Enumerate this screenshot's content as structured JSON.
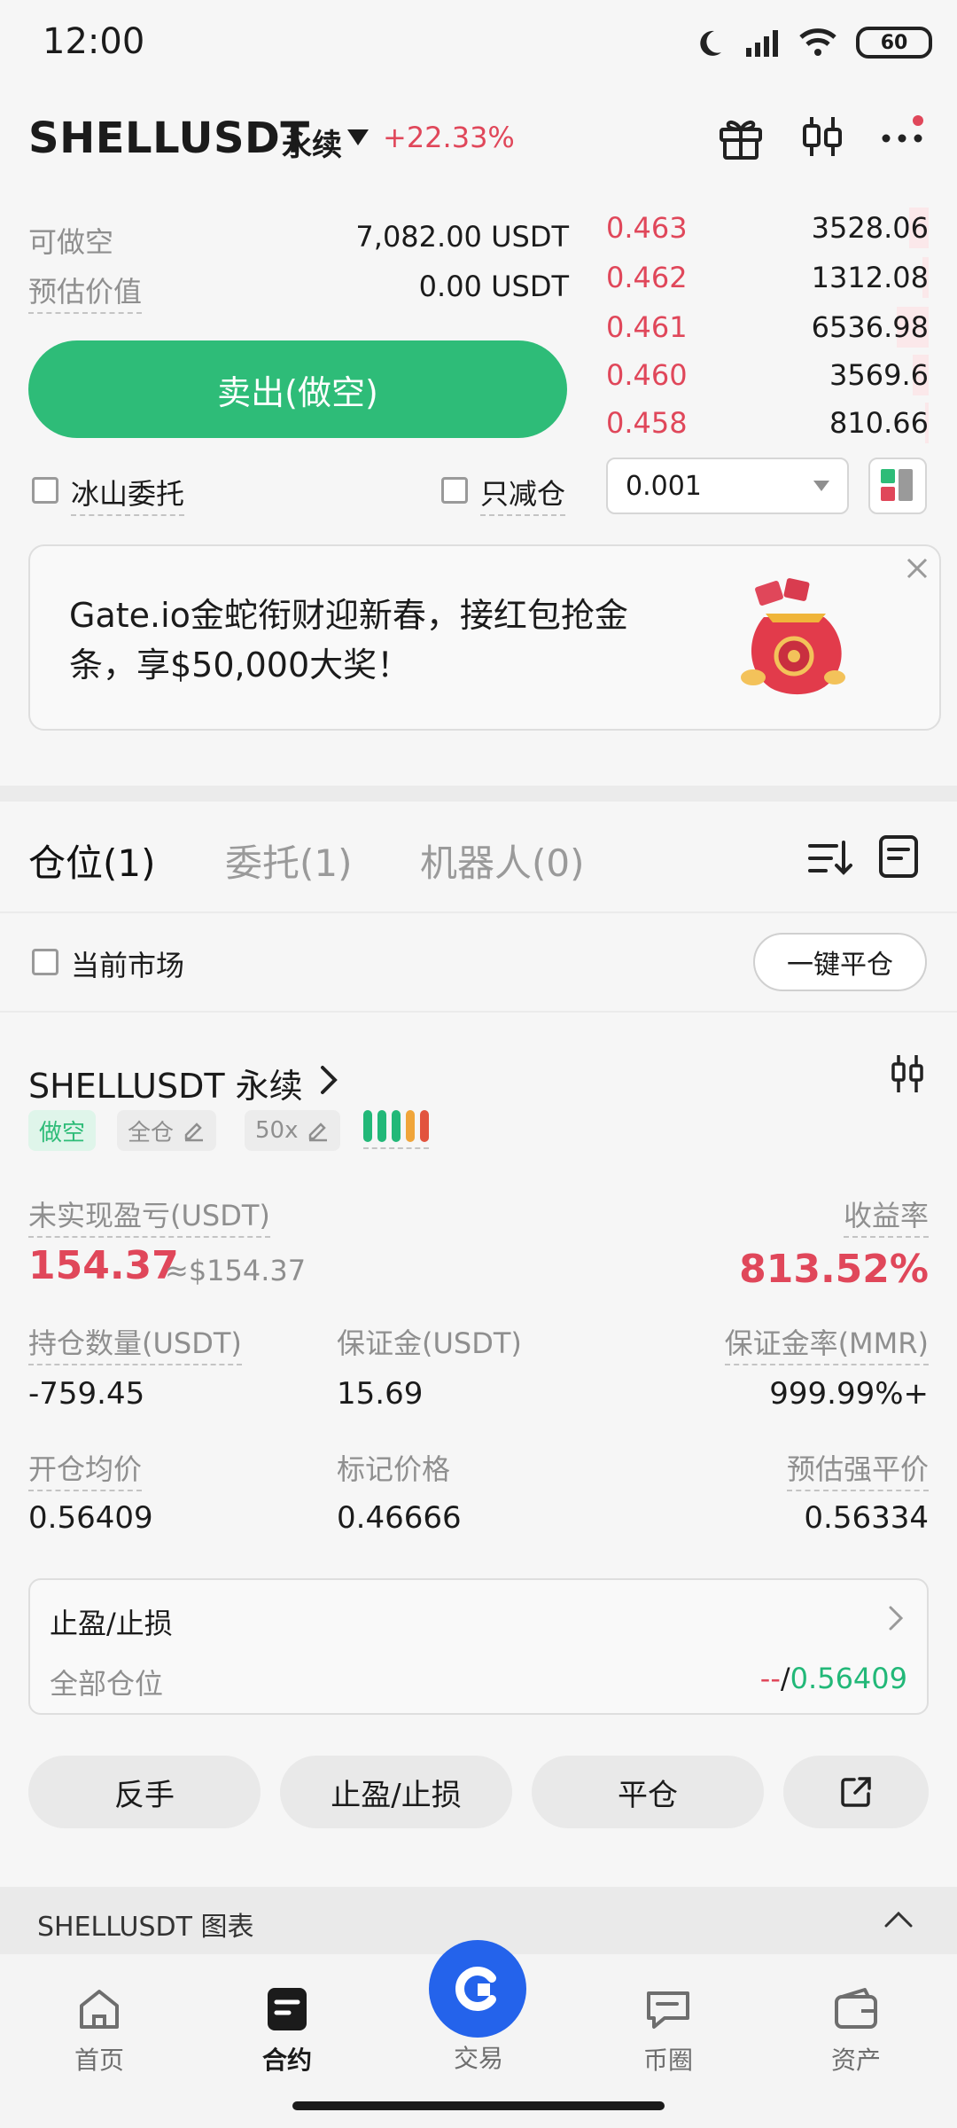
{
  "status_bar": {
    "time": "12:00",
    "battery": "60"
  },
  "header": {
    "pair": "SHELLUSDT",
    "contract_type": "永续",
    "change": "+22.33%"
  },
  "order_form": {
    "short_available_label": "可做空",
    "short_available_value": "7,082.00 USDT",
    "est_value_label": "预估价值",
    "est_value_value": "0.00 USDT",
    "sell_button": "卖出(做空)",
    "iceberg_label": "冰山委托",
    "reduce_only_label": "只减仓"
  },
  "order_book": {
    "rows": [
      {
        "price": "0.463",
        "qty": "3528.06",
        "depth": 0.06
      },
      {
        "price": "0.462",
        "qty": "1312.08",
        "depth": 0.02
      },
      {
        "price": "0.461",
        "qty": "6536.98",
        "depth": 0.1
      },
      {
        "price": "0.460",
        "qty": "3569.6",
        "depth": 0.05
      },
      {
        "price": "0.458",
        "qty": "810.66",
        "depth": 0.01
      }
    ],
    "precision": "0.001"
  },
  "promo": {
    "text": "Gate.io金蛇衔财迎新春，接红包抢金条，享$50,000大奖！"
  },
  "tabs": {
    "positions": "仓位(1)",
    "orders": "委托(1)",
    "bots": "机器人(0)"
  },
  "filter": {
    "current_market": "当前市场",
    "close_all": "一键平仓"
  },
  "position": {
    "title": "SHELLUSDT 永续",
    "tag_side": "做空",
    "tag_margin": "全仓",
    "tag_leverage": "50x",
    "unrealized_label": "未实现盈亏(USDT)",
    "unrealized_value": "154.37",
    "unrealized_usd": "≈$154.37",
    "roe_label": "收益率",
    "roe_value": "813.52%",
    "size_label": "持仓数量(USDT)",
    "size_value": "-759.45",
    "margin_label": "保证金(USDT)",
    "margin_value": "15.69",
    "mmr_label": "保证金率(MMR)",
    "mmr_value": "999.99%+",
    "entry_label": "开仓均价",
    "entry_value": "0.56409",
    "mark_label": "标记价格",
    "mark_value": "0.46666",
    "liq_label": "预估强平价",
    "liq_value": "0.56334",
    "tpsl_title": "止盈/止损",
    "tpsl_scope": "全部仓位",
    "tpsl_tp": "--",
    "tpsl_sep": "/",
    "tpsl_sl": "0.56409"
  },
  "actions": {
    "reverse": "反手",
    "tpsl": "止盈/止损",
    "close": "平仓"
  },
  "chart_bar": {
    "label": "SHELLUSDT 图表"
  },
  "bottom_nav": {
    "home": "首页",
    "futures": "合约",
    "trade": "交易",
    "community": "币圈",
    "assets": "资产"
  },
  "colors": {
    "up": "#2ebc78",
    "down": "#e0475a",
    "brand": "#2463eb"
  }
}
